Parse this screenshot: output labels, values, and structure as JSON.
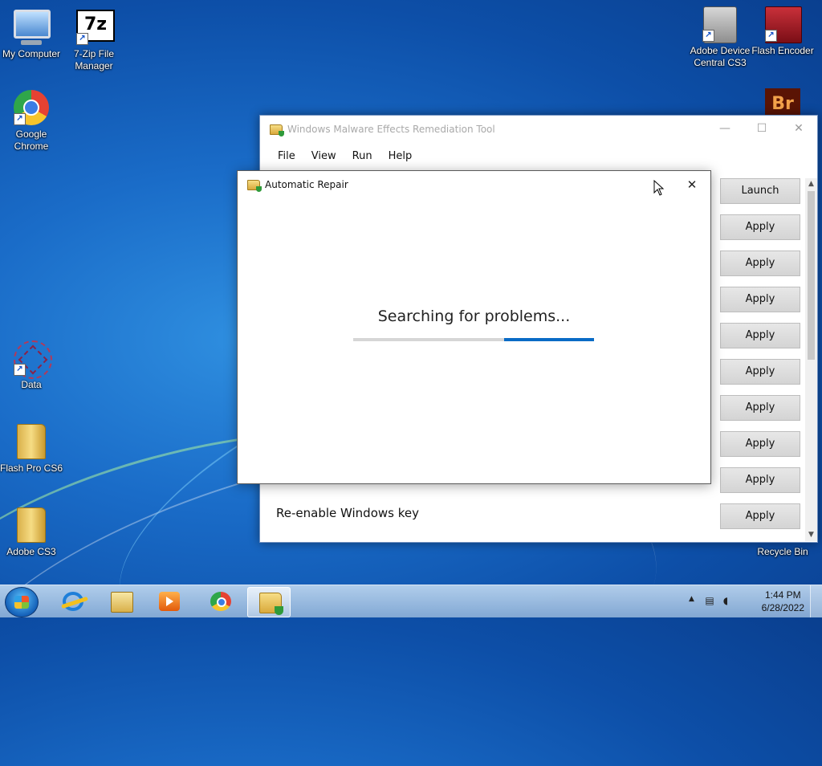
{
  "desktop": {
    "icons": [
      {
        "label": "My Computer",
        "icon": "computer-icon"
      },
      {
        "label": "7-Zip File Manager",
        "icon": "7zip-icon",
        "glyph": "7z"
      },
      {
        "label": "Google Chrome",
        "icon": "chrome-icon"
      },
      {
        "label": "Data",
        "icon": "data-icon"
      },
      {
        "label": "Flash Pro CS6",
        "icon": "folder-icon"
      },
      {
        "label": "Adobe CS3",
        "icon": "folder-icon"
      },
      {
        "label": "Adobe Device Central CS3",
        "icon": "device-central-icon"
      },
      {
        "label": "Flash Encoder",
        "icon": "flash-encoder-icon"
      },
      {
        "label": "",
        "icon": "bridge-icon",
        "glyph": "Br"
      },
      {
        "label": "Recycle Bin",
        "icon": "recycle-bin-icon"
      }
    ]
  },
  "main_window": {
    "title": "Windows Malware Effects Remediation Tool",
    "menu": [
      "File",
      "View",
      "Run",
      "Help"
    ],
    "controls": {
      "minimize": "—",
      "maximize": "☐",
      "close": "✕"
    },
    "visible_row_label": "Re-enable Windows key",
    "buttons": [
      "Launch",
      "Apply",
      "Apply",
      "Apply",
      "Apply",
      "Apply",
      "Apply",
      "Apply",
      "Apply",
      "Apply"
    ]
  },
  "dialog": {
    "title": "Automatic Repair",
    "close": "✕",
    "status_text": "Searching for problems...",
    "progress": "indeterminate"
  },
  "taskbar": {
    "items": [
      "start-button",
      "internet-explorer",
      "windows-explorer",
      "windows-media-player",
      "google-chrome",
      "remediation-tool"
    ],
    "active_item": "remediation-tool",
    "clock_time": "1:44 PM",
    "clock_date": "6/28/2022"
  },
  "colors": {
    "accent": "#0a6bc6",
    "desktop_bg": "#1a6cc8"
  }
}
